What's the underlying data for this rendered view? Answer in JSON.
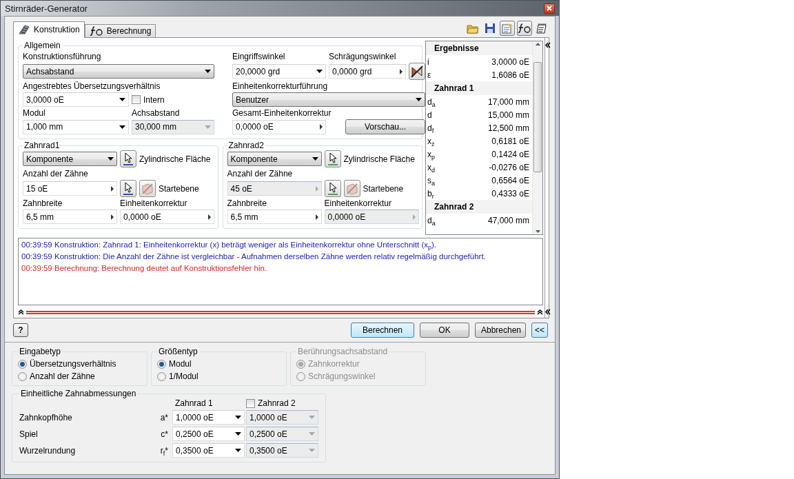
{
  "window": {
    "title": "Stirnräder-Generator"
  },
  "tabs": [
    {
      "label": "Konstruktion",
      "selected": true
    },
    {
      "label": "Berechnung",
      "selected": false
    }
  ],
  "allgemein": {
    "title": "Allgemein",
    "konstruktionsfuehrung": {
      "label": "Konstruktionsführung",
      "value": "Achsabstand"
    },
    "eingriffswinkel": {
      "label": "Eingriffswinkel",
      "value": "20,0000 grd"
    },
    "schraegungswinkel": {
      "label": "Schrägungswinkel",
      "value": "0,0000 grd"
    },
    "uebersetzung": {
      "label": "Angestrebtes Übersetzungsverhältnis",
      "value": "3,0000 oE"
    },
    "intern": {
      "label": "Intern",
      "checked": false
    },
    "korrekturfuehrung": {
      "label": "Einheitenkorrekturführung",
      "value": "Benutzer"
    },
    "modul": {
      "label": "Modul",
      "value": "1,000 mm"
    },
    "achsabstand": {
      "label": "Achsabstand",
      "value": "30,000 mm",
      "disabled": true
    },
    "gesamt": {
      "label": "Gesamt-Einheitenkorrektur",
      "value": "0,0000 oE"
    },
    "preview_button": "Vorschau..."
  },
  "gears": [
    {
      "title": "Zahnrad1",
      "type": "Komponente",
      "surface": "Zylindrische Fläche",
      "plane": "Startebene",
      "teeth_label": "Anzahl der Zähne",
      "teeth": "15 oE",
      "teeth_disabled": false,
      "width_label": "Zahnbreite",
      "width": "6,5 mm",
      "correction_label": "Einheitenkorrektur",
      "correction": "0,0000 oE",
      "correction_disabled": false
    },
    {
      "title": "Zahnrad2",
      "type": "Komponente",
      "surface": "Zylindrische Fläche",
      "plane": "Startebene",
      "teeth_label": "Anzahl der Zähne",
      "teeth": "45 oE",
      "teeth_disabled": true,
      "width_label": "Zahnbreite",
      "width": "6,5 mm",
      "correction_label": "Einheitenkorrektur",
      "correction": "0,0000 oE",
      "correction_disabled": true
    }
  ],
  "results": {
    "title": "Ergebnisse",
    "rows": [
      {
        "kind": "value",
        "symbol": "i",
        "value": "3,0000 oE"
      },
      {
        "kind": "value",
        "symbol": "ε",
        "value": "1,6086 oE"
      },
      {
        "kind": "header",
        "symbol": "Zahnrad 1"
      },
      {
        "kind": "value",
        "symbol": "d$_{a}$",
        "value": "17,000 mm"
      },
      {
        "kind": "value",
        "symbol": "d",
        "value": "15,000 mm"
      },
      {
        "kind": "value",
        "symbol": "d$_{f}$",
        "value": "12,500 mm"
      },
      {
        "kind": "value",
        "symbol": "x$_{z}$",
        "value": "0,6181 oE"
      },
      {
        "kind": "value",
        "symbol": "x$_{p}$",
        "value": "0,1424 oE"
      },
      {
        "kind": "value",
        "symbol": "x$_{d}$",
        "value": "-0,0276 oE"
      },
      {
        "kind": "value",
        "symbol": "s$_{a}$",
        "value": "0,6564 oE"
      },
      {
        "kind": "value",
        "symbol": "b$_{r}$",
        "value": "0,4333 oE"
      },
      {
        "kind": "header",
        "symbol": "Zahnrad 2"
      },
      {
        "kind": "value",
        "symbol": "d$_{a}$",
        "value": "47,000 mm"
      }
    ]
  },
  "messages": [
    {
      "kind": "info",
      "text": "00:39:59 Konstruktion: Zahnrad 1: Einheitenkorrektur (x) beträgt weniger als Einheitenkorrektur ohne Unterschnitt (x$_{p}$)."
    },
    {
      "kind": "info",
      "text": "00:39:59 Konstruktion: Die Anzahl der Zähne ist vergleichbar - Aufnahmen derselben Zähne werden relativ regelmäßig durchgeführt."
    },
    {
      "kind": "error",
      "text": "00:39:59 Berechnung: Berechnung deutet auf Konstruktionsfehler hin."
    }
  ],
  "help_button": "?",
  "buttons": [
    {
      "label": "Berechnen",
      "focused": true
    },
    {
      "label": "OK",
      "focused": false
    },
    {
      "label": "Abbrechen",
      "focused": false
    }
  ],
  "collapse_button": "<<",
  "option_groups": [
    {
      "title": "Eingabetyp",
      "disabled": false,
      "options": [
        {
          "label": "Übersetzungsverhältnis",
          "selected": true
        },
        {
          "label": "Anzahl der Zähne",
          "selected": false
        }
      ]
    },
    {
      "title": "Größentyp",
      "disabled": false,
      "options": [
        {
          "label": "Modul",
          "selected": true
        },
        {
          "label": "1/Modul",
          "selected": false
        }
      ]
    },
    {
      "title": "Berührungsachsabstand",
      "disabled": true,
      "options": [
        {
          "label": "Zahnkorrektur",
          "selected": true
        },
        {
          "label": "Schrägungswinkel",
          "selected": false
        }
      ]
    }
  ],
  "dimensions": {
    "title": "Einheitliche Zahnabmessungen",
    "column_1": "Zahnrad 1",
    "column_2": {
      "label": "Zahnrad 2",
      "checked": false
    },
    "rows": [
      {
        "label": "Zahnkopfhöhe",
        "symbol": "a*",
        "value_1": "1,0000 oE",
        "value_2": "1,0000 oE"
      },
      {
        "label": "Spiel",
        "symbol": "c*",
        "value_1": "0,2500 oE",
        "value_2": "0,2500 oE"
      },
      {
        "label": "Wurzelrundung",
        "symbol": "r$_{f}$*",
        "value_1": "0,3500 oE",
        "value_2": "0,3500 oE"
      }
    ]
  }
}
